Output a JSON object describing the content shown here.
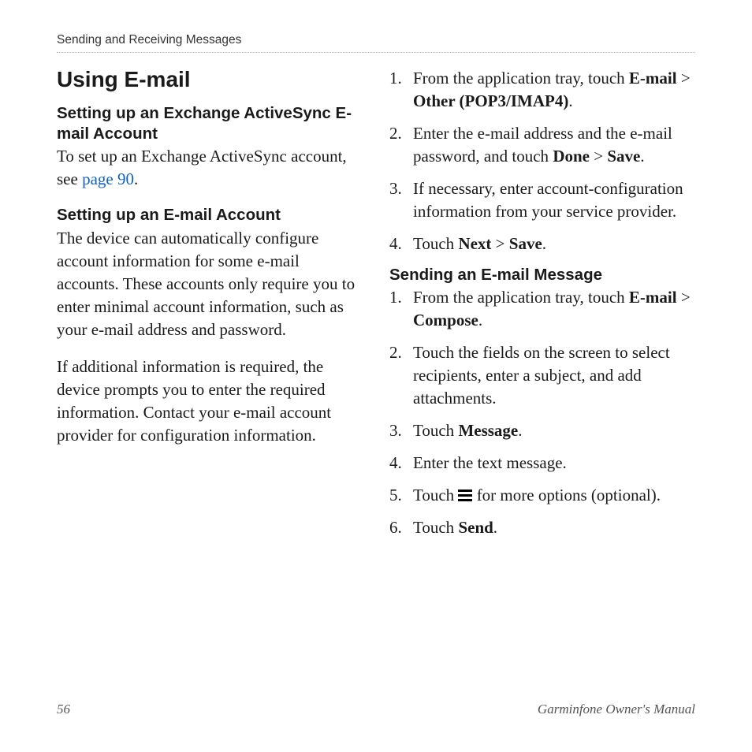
{
  "header": {
    "running": "Sending and Receiving Messages"
  },
  "left": {
    "h1": "Using E-mail",
    "sec1_title": "Setting up an Exchange ActiveSync E-mail Account",
    "sec1_body_a": "To set up an Exchange ActiveSync account, see ",
    "sec1_link": "page 90",
    "sec1_body_b": ".",
    "sec2_title": "Setting up an E-mail Account",
    "sec2_p1": "The device can automatically configure account information for some e-mail accounts. These accounts only require you to enter minimal account information, such as your e-mail address and password.",
    "sec2_p2": "If additional information is required, the device prompts you to enter the required information. Contact your e-mail account provider for configuration information."
  },
  "right": {
    "listA": {
      "i1_a": "From the application tray, touch ",
      "i1_b": "E-mail",
      "i1_c": " > ",
      "i1_d": "Other (POP3/IMAP4)",
      "i1_e": ".",
      "i2_a": "Enter the e-mail address and the e-mail password, and touch ",
      "i2_b": "Done",
      "i2_c": " > ",
      "i2_d": "Save",
      "i2_e": ".",
      "i3": "If necessary, enter account-configuration information from your service provider.",
      "i4_a": "Touch ",
      "i4_b": "Next",
      "i4_c": " > ",
      "i4_d": "Save",
      "i4_e": "."
    },
    "sec3_title": "Sending an E-mail Message",
    "listB": {
      "i1_a": "From the application tray, touch ",
      "i1_b": "E-mail",
      "i1_c": " > ",
      "i1_d": "Compose",
      "i1_e": ".",
      "i2": "Touch the fields on the screen to select recipients, enter a subject, and add attachments.",
      "i3_a": "Touch ",
      "i3_b": "Message",
      "i3_c": ".",
      "i4": "Enter the text message.",
      "i5_a": "Touch ",
      "i5_b": " for more options (optional).",
      "i6_a": "Touch ",
      "i6_b": "Send",
      "i6_c": "."
    }
  },
  "footer": {
    "page": "56",
    "title": "Garminfone Owner's Manual"
  }
}
